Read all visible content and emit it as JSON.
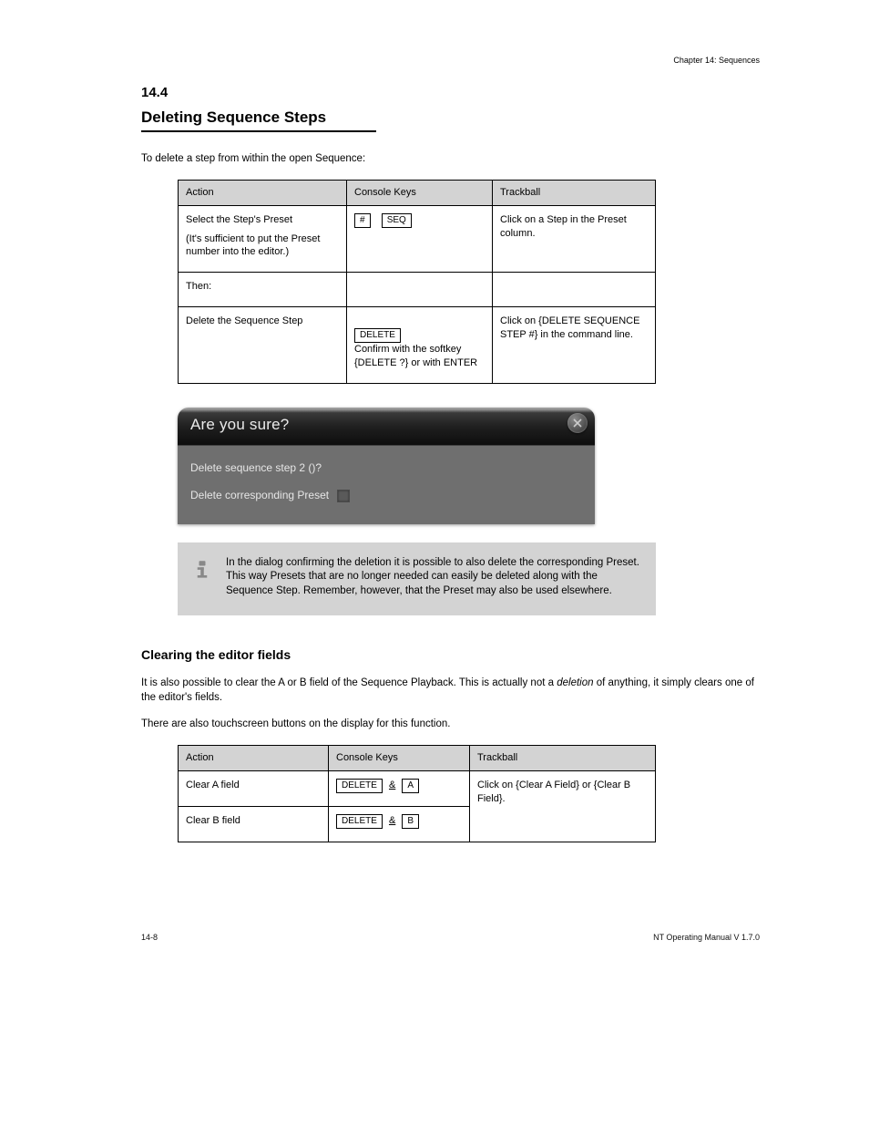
{
  "chapterRef": "Chapter 14: Sequences",
  "section": {
    "number": "14.4",
    "title": "Deleting Sequence Steps"
  },
  "intro": "To delete a step from within the open Sequence:",
  "table1": {
    "headers": {
      "c1": "Action",
      "c2": "Console Keys",
      "c3": "Trackball"
    },
    "rows": [
      {
        "action_pre": "Select the Step's Preset",
        "action_note": "(It's sufficient to put the Preset number into the editor.)",
        "keys_pre": "",
        "keys_keycaps": [
          "#",
          "SEQ"
        ],
        "keys_post": "",
        "track": "Click on a Step in the Preset column."
      },
      {
        "action_pre": "Then:",
        "action_note": "",
        "keys_pre": "",
        "keys_keycaps": [],
        "keys_post": "",
        "track": ""
      },
      {
        "action_pre": "Delete the Sequence Step",
        "action_note": "",
        "keys_pre": "",
        "keys_keycaps": [
          "DELETE"
        ],
        "keys_post": "\nConfirm with the softkey {DELETE ?} or with ENTER",
        "track": "Click on {DELETE SEQUENCE STEP #} in the command line."
      }
    ]
  },
  "dialog": {
    "title": "Are you sure?",
    "line1": "Delete sequence step 2 ()?",
    "line2": "Delete corresponding Preset"
  },
  "infobox": "In the dialog confirming the deletion it is possible to also delete the corresponding Preset. This way Presets that are no longer needed can easily be deleted along with the Sequence Step. Remember, however, that the Preset may also be used elsewhere.",
  "subsection": {
    "title": "Clearing the editor fields",
    "p1_pre": "It is also possible to clear the A or B field of the Sequence Playback. This is actually not a ",
    "p1_em": "deletion",
    "p1_post": " of anything, it simply clears one of the editor's fields.",
    "p2": "There are also touchscreen buttons on the display for this function."
  },
  "table2": {
    "headers": {
      "c1": "Action",
      "c2": "Console Keys",
      "c3": "Trackball"
    },
    "rows": [
      {
        "action": "Clear A field",
        "amp": "&",
        "keycaps": [
          "DELETE",
          "A"
        ],
        "track": "Click on {Clear A Field} or {Clear B Field}."
      },
      {
        "action": "Clear B field",
        "amp": "&",
        "keycaps": [
          "DELETE",
          "B"
        ],
        "track": ""
      }
    ]
  },
  "footer": {
    "left": "14-8",
    "right": "NT Operating Manual V 1.7.0"
  }
}
